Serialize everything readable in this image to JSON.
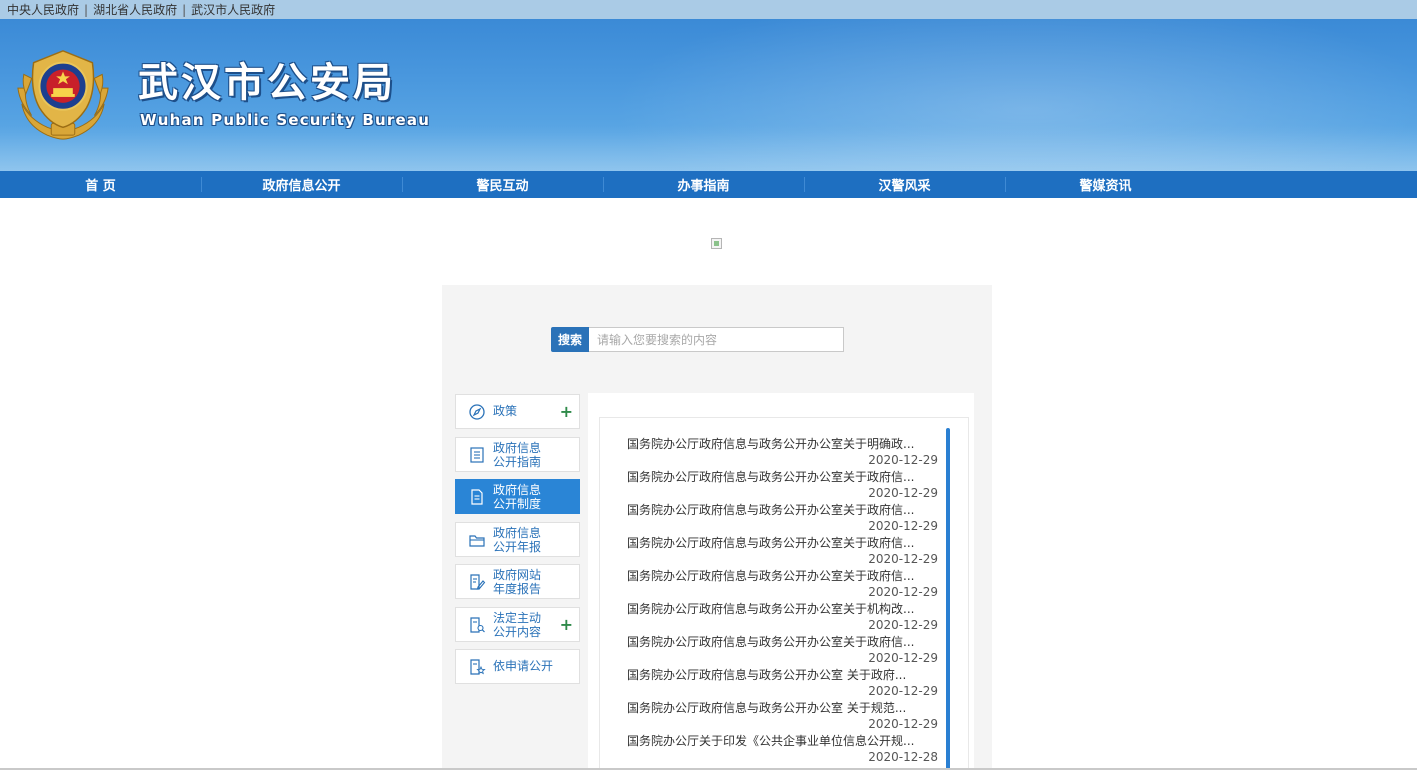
{
  "topbar": {
    "links": [
      "中央人民政府",
      "湖北省人民政府",
      "武汉市人民政府"
    ]
  },
  "header": {
    "title": "武汉市公安局",
    "subtitle": "Wuhan Public Security Bureau",
    "emblem_icon": "police-emblem-icon"
  },
  "nav": {
    "items": [
      "首 页",
      "政府信息公开",
      "警民互动",
      "办事指南",
      "汉警风采",
      "警媒资讯"
    ]
  },
  "search": {
    "button_label": "搜索",
    "placeholder": "请输入您要搜索的内容"
  },
  "sidebar": {
    "items": [
      {
        "label": "政策",
        "icon": "compass-icon",
        "expandable": true,
        "active": false
      },
      {
        "label_line1": "政府信息",
        "label_line2": "公开指南",
        "icon": "list-document-icon",
        "expandable": false,
        "active": false
      },
      {
        "label_line1": "政府信息",
        "label_line2": "公开制度",
        "icon": "document-icon",
        "expandable": false,
        "active": true
      },
      {
        "label_line1": "政府信息",
        "label_line2": "公开年报",
        "icon": "folder-icon",
        "expandable": false,
        "active": false
      },
      {
        "label_line1": "政府网站",
        "label_line2": "年度报告",
        "icon": "edit-document-icon",
        "expandable": false,
        "active": false
      },
      {
        "label_line1": "法定主动",
        "label_line2": "公开内容",
        "icon": "search-document-icon",
        "expandable": true,
        "active": false
      },
      {
        "label": "依申请公开",
        "icon": "star-document-icon",
        "expandable": false,
        "active": false
      }
    ],
    "plus_symbol": "+"
  },
  "list": {
    "items": [
      {
        "title": "国务院办公厅政府信息与政务公开办公室关于明确政...",
        "date": "2020-12-29"
      },
      {
        "title": "国务院办公厅政府信息与政务公开办公室关于政府信...",
        "date": "2020-12-29"
      },
      {
        "title": "国务院办公厅政府信息与政务公开办公室关于政府信...",
        "date": "2020-12-29"
      },
      {
        "title": "国务院办公厅政府信息与政务公开办公室关于政府信...",
        "date": "2020-12-29"
      },
      {
        "title": "国务院办公厅政府信息与政务公开办公室关于政府信...",
        "date": "2020-12-29"
      },
      {
        "title": "国务院办公厅政府信息与政务公开办公室关于机构改...",
        "date": "2020-12-29"
      },
      {
        "title": "国务院办公厅政府信息与政务公开办公室关于政府信...",
        "date": "2020-12-29"
      },
      {
        "title": "国务院办公厅政府信息与政务公开办公室 关于政府...",
        "date": "2020-12-29"
      },
      {
        "title": "国务院办公厅政府信息与政务公开办公室 关于规范...",
        "date": "2020-12-29"
      },
      {
        "title": "国务院办公厅关于印发《公共企事业单位信息公开规...",
        "date": "2020-12-28"
      }
    ]
  },
  "colors": {
    "nav_bg": "#1e6fc1",
    "accent_blue": "#2a72b8",
    "active_blue": "#2a85d6",
    "plus_green": "#2f8a4a"
  }
}
